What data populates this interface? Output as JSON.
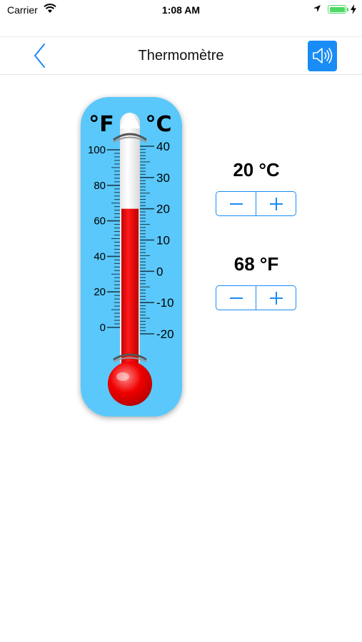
{
  "status_bar": {
    "carrier": "Carrier",
    "time": "1:08 AM",
    "battery": 1.0
  },
  "nav": {
    "title": "Thermomètre"
  },
  "thermometer": {
    "fahrenheit_unit": "°F",
    "celsius_unit": "°C",
    "fahrenheit_ticks": [
      "100",
      "80",
      "60",
      "40",
      "20",
      "0"
    ],
    "celsius_ticks": [
      "40",
      "30",
      "20",
      "10",
      "0",
      "-10",
      "-20"
    ],
    "current_celsius": 20,
    "colors": {
      "background": "#5ac8fa",
      "mercury": "#ee0000"
    }
  },
  "celsius_readout": {
    "value": "20 °C"
  },
  "fahrenheit_readout": {
    "value": "68 °F"
  },
  "colors": {
    "accent": "#1a8cf5"
  }
}
